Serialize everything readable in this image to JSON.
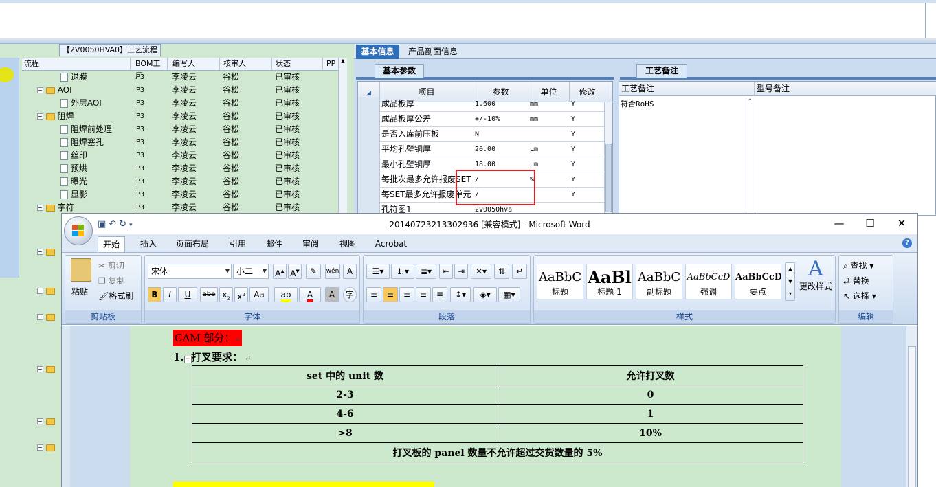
{
  "left_panel": {
    "tab_label": "【2V0050HVA0】工艺流程",
    "columns": [
      "流程",
      "BOM工厂",
      "编写人",
      "核审人",
      "状态",
      "PP"
    ],
    "rows": [
      {
        "name": "退膜",
        "indent": 2,
        "type": "doc",
        "bom": "P3",
        "writer": "李凌云",
        "reviewer": "谷松",
        "status": "已审核"
      },
      {
        "name": "AOI",
        "indent": 1,
        "type": "folder",
        "bom": "P3",
        "writer": "李凌云",
        "reviewer": "谷松",
        "status": "已审核"
      },
      {
        "name": "外层AOI",
        "indent": 2,
        "type": "doc",
        "bom": "P3",
        "writer": "李凌云",
        "reviewer": "谷松",
        "status": "已审核"
      },
      {
        "name": "阻焊",
        "indent": 1,
        "type": "folder",
        "bom": "P3",
        "writer": "李凌云",
        "reviewer": "谷松",
        "status": "已审核"
      },
      {
        "name": "阻焊前处理",
        "indent": 2,
        "type": "doc",
        "bom": "P3",
        "writer": "李凌云",
        "reviewer": "谷松",
        "status": "已审核"
      },
      {
        "name": "阻焊塞孔",
        "indent": 2,
        "type": "doc",
        "bom": "P3",
        "writer": "李凌云",
        "reviewer": "谷松",
        "status": "已审核"
      },
      {
        "name": "丝印",
        "indent": 2,
        "type": "doc",
        "bom": "P3",
        "writer": "李凌云",
        "reviewer": "谷松",
        "status": "已审核"
      },
      {
        "name": "预烘",
        "indent": 2,
        "type": "doc",
        "bom": "P3",
        "writer": "李凌云",
        "reviewer": "谷松",
        "status": "已审核"
      },
      {
        "name": "曝光",
        "indent": 2,
        "type": "doc",
        "bom": "P3",
        "writer": "李凌云",
        "reviewer": "谷松",
        "status": "已审核"
      },
      {
        "name": "显影",
        "indent": 2,
        "type": "doc",
        "bom": "P3",
        "writer": "李凌云",
        "reviewer": "谷松",
        "status": "已审核"
      },
      {
        "name": "字符",
        "indent": 1,
        "type": "folder",
        "bom": "P3",
        "writer": "李凌云",
        "reviewer": "谷松",
        "status": "已审核"
      }
    ]
  },
  "right_panel": {
    "tabs": [
      "基本信息",
      "产品剖面信息"
    ],
    "subtab_params": "基本参数",
    "subtab_notes": "工艺备注",
    "grid_columns": [
      "项目",
      "参数",
      "单位",
      "修改"
    ],
    "grid_rows": [
      {
        "item": "成品板厚",
        "param": "1.600",
        "unit": "mm",
        "mod": "Y"
      },
      {
        "item": "成品板厚公差",
        "param": "+/-10%",
        "unit": "mm",
        "mod": "Y"
      },
      {
        "item": "是否入库前压板",
        "param": "N",
        "unit": "",
        "mod": "Y"
      },
      {
        "item": "平均孔壁铜厚",
        "param": "20.00",
        "unit": "μm",
        "mod": "Y"
      },
      {
        "item": "最小孔壁铜厚",
        "param": "18.00",
        "unit": "μm",
        "mod": "Y"
      },
      {
        "item": "每批次最多允许报废SET",
        "param": "/",
        "unit": "%",
        "mod": "Y"
      },
      {
        "item": "每SET最多允许报废单元",
        "param": "/",
        "unit": "",
        "mod": "Y"
      },
      {
        "item": "孔符图1",
        "param": "2v0050hva",
        "unit": "",
        "mod": ""
      }
    ],
    "notes_columns": [
      "工艺备注",
      "型号备注"
    ],
    "notes_value": "符合RoHS"
  },
  "word": {
    "title": "20140723213302936 [兼容模式] - Microsoft Word",
    "ribbon_tabs": [
      "开始",
      "插入",
      "页面布局",
      "引用",
      "邮件",
      "审阅",
      "视图",
      "Acrobat"
    ],
    "clipboard": {
      "paste": "粘贴",
      "cut": "剪切",
      "copy": "复制",
      "format_painter": "格式刷",
      "label": "剪贴板"
    },
    "font": {
      "name": "宋体",
      "size": "小二",
      "label": "字体"
    },
    "paragraph_label": "段落",
    "styles": [
      {
        "sample": "AaBbC",
        "name": "标题"
      },
      {
        "sample": "AaBl",
        "name": "标题 1"
      },
      {
        "sample": "AaBbC",
        "name": "副标题"
      },
      {
        "sample": "AaBbCcD",
        "name": "强调"
      },
      {
        "sample": "AaBbCcD",
        "name": "要点"
      }
    ],
    "change_styles": "更改样式",
    "styles_label": "样式",
    "editing": {
      "find": "查找",
      "replace": "替换",
      "select": "选择",
      "label": "编辑"
    },
    "document": {
      "section_title": "CAM 部分：",
      "item1_number": "1.",
      "item1_title": "打叉要求：",
      "table_header": [
        "set 中的 unit 数",
        "允许打叉数"
      ],
      "table_rows": [
        [
          "2-3",
          "0"
        ],
        [
          "4-6",
          "1"
        ],
        [
          ">8",
          "10%"
        ]
      ],
      "table_footer": "打叉板的 panel 数量不允许超过交货数量的 5%"
    }
  }
}
